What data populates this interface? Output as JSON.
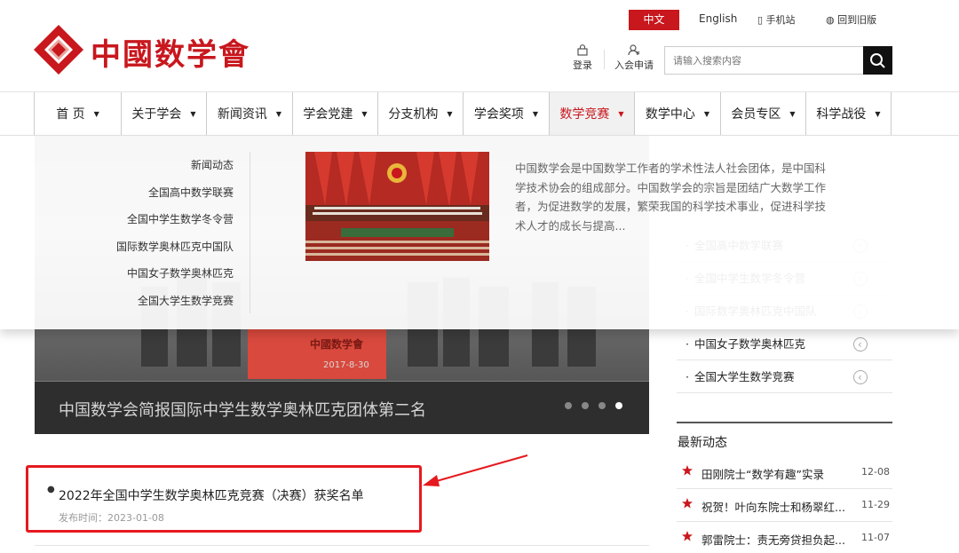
{
  "header": {
    "logo_text": "中國数学會",
    "lang_cn": "中文",
    "lang_en": "English",
    "mobile": "手机站",
    "old_version": "回到旧版",
    "login": "登录",
    "join": "入会申请",
    "search_placeholder": "请输入搜索内容",
    "brand_color": "#c8171d"
  },
  "nav": {
    "items": [
      {
        "label": "首 页",
        "w": 98
      },
      {
        "label": "关于学会",
        "w": 96
      },
      {
        "label": "新闻资讯",
        "w": 97
      },
      {
        "label": "学会党建",
        "w": 96
      },
      {
        "label": "分支机构",
        "w": 96
      },
      {
        "label": "学会奖项",
        "w": 97
      },
      {
        "label": "数学竞赛",
        "w": 96
      },
      {
        "label": "数学中心",
        "w": 97
      },
      {
        "label": "会员专区",
        "w": 96
      },
      {
        "label": "科学战役",
        "w": 96
      }
    ],
    "active_index": 6
  },
  "dropdown": {
    "items": [
      "新闻动态",
      "全国高中数学联赛",
      "全国中学生数学冬令营",
      "国际数学奥林匹克中国队",
      "中国女子数学奥林匹克",
      "全国大学生数学竞赛"
    ],
    "description": "中国数学会是中国数学工作者的学术性法人社会团体，是中国科学技术协会的组成部分。中国数学会的宗旨是团结广大数学工作者，为促进数学的发展，繁荣我国的科学技术事业，促进科学技术人才的成长与提高..."
  },
  "slideshow": {
    "caption": "中国数学会简报国际中学生数学奥林匹克团体第二名",
    "banner_text": "中國数学會",
    "date": "2017-8-30",
    "dots": 4,
    "active_dot": 3
  },
  "right_list": {
    "items": [
      "全国高中数学联赛",
      "全国中学生数学冬令营",
      "国际数学奥林匹克中国队",
      "中国女子数学奥林匹克",
      "全国大学生数学竞赛"
    ]
  },
  "latest": {
    "title": "最新动态",
    "items": [
      {
        "title": "田刚院士“数学有趣”实录",
        "date": "12-08"
      },
      {
        "title": "祝贺！叶向东院士和杨翠红...",
        "date": "11-29"
      },
      {
        "title": "郭雷院士：责无旁贷担负起...",
        "date": "11-07"
      }
    ]
  },
  "article": {
    "title": "2022年全国中学生数学奥林匹克竞赛（决赛）获奖名单",
    "meta": "发布时间：2023-01-08"
  }
}
